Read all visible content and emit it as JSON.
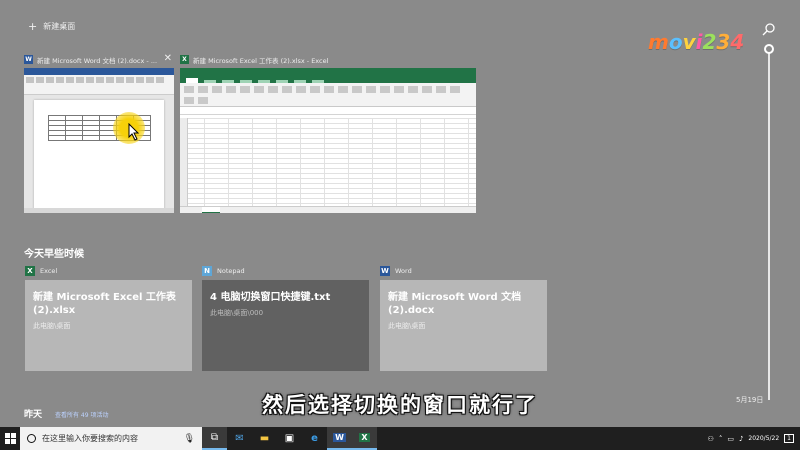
{
  "colors": {
    "word": "#2b579a",
    "excel": "#217346",
    "notepad": "#5ea6d7",
    "background": "#8a8a8a",
    "taskbar": "#1f1f1f"
  },
  "top": {
    "new_desktop_label": "新建桌面",
    "search_icon": "search-icon"
  },
  "watermark": {
    "letters": [
      "m",
      "o",
      "v",
      "i",
      "2",
      "3",
      "4"
    ],
    "colors": [
      "#ff7a2f",
      "#5bc0ff",
      "#ffd23f",
      "#ff5aa5",
      "#9be15d",
      "#ffae3a",
      "#ff6a6a"
    ]
  },
  "windows": [
    {
      "app_icon": "W",
      "title": "新建 Microsoft Word 文档 (2).docx - ..."
    },
    {
      "app_icon": "X",
      "title": "新建 Microsoft Excel 工作表 (2).xlsx - Excel"
    }
  ],
  "timeline": {
    "section_title": "今天早些时候",
    "side_date": "5月19日",
    "cards": [
      {
        "app": "Excel",
        "app_icon": "X",
        "title": "新建 Microsoft Excel 工作表 (2).xlsx",
        "path": "此电脑\\桌面"
      },
      {
        "app": "Notepad",
        "app_icon": "N",
        "title": "4 电脑切换窗口快捷键.txt",
        "path": "此电脑\\桌面\\000"
      },
      {
        "app": "Word",
        "app_icon": "W",
        "title": "新建 Microsoft Word 文档 (2).docx",
        "path": "此电脑\\桌面"
      }
    ]
  },
  "yesterday": {
    "label": "昨天",
    "note": "查看所有 49 项活动"
  },
  "subtitle": "然后选择切换的窗口就行了",
  "taskbar": {
    "search_placeholder": "在这里输入你要搜索的内容",
    "clock_date": "2020/5/22",
    "notification_count": "1"
  }
}
